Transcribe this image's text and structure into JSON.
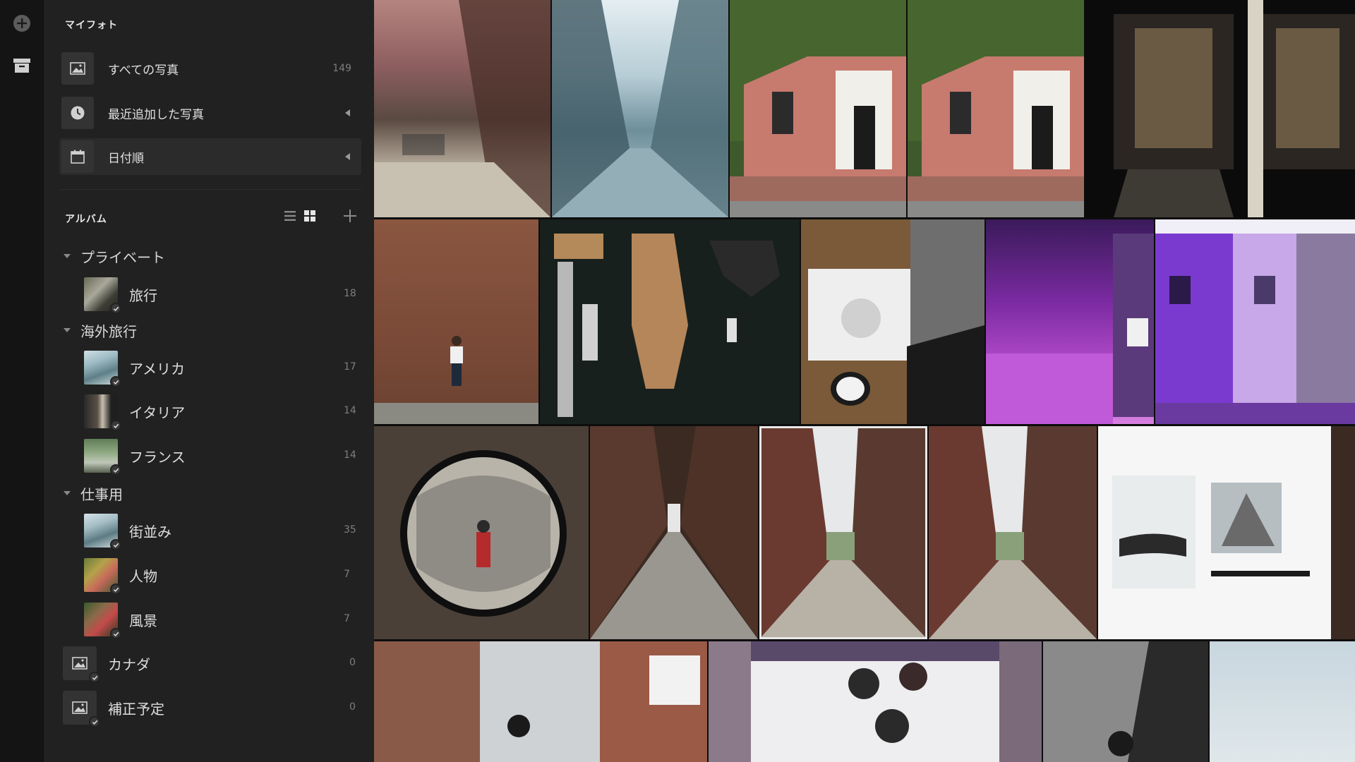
{
  "rail": {
    "add_icon": "add-circle-icon",
    "archive_icon": "archive-icon"
  },
  "library": {
    "title": "マイフォト",
    "items": [
      {
        "label": "すべての写真",
        "count": "149",
        "icon": "photo-icon"
      },
      {
        "label": "最近追加した写真",
        "icon": "clock-icon"
      },
      {
        "label": "日付順",
        "icon": "calendar-icon"
      }
    ]
  },
  "albums": {
    "title": "アルバム",
    "groups": [
      {
        "label": "プライベート",
        "albums": [
          {
            "label": "旅行",
            "count": "18"
          }
        ]
      },
      {
        "label": "海外旅行",
        "albums": [
          {
            "label": "アメリカ",
            "count": "17"
          },
          {
            "label": "イタリア",
            "count": "14"
          },
          {
            "label": "フランス",
            "count": "14"
          }
        ]
      },
      {
        "label": "仕事用",
        "albums": [
          {
            "label": "街並み",
            "count": "35"
          },
          {
            "label": "人物",
            "count": "7"
          },
          {
            "label": "風景",
            "count": "7"
          }
        ]
      }
    ],
    "loose": [
      {
        "label": "カナダ",
        "count": "0"
      },
      {
        "label": "補正予定",
        "count": "0"
      }
    ]
  },
  "colors": {
    "sidebar_bg": "#212121",
    "rail_bg": "#141414",
    "grid_bg": "#0d0d0d",
    "selection": "#e8e8e8"
  }
}
